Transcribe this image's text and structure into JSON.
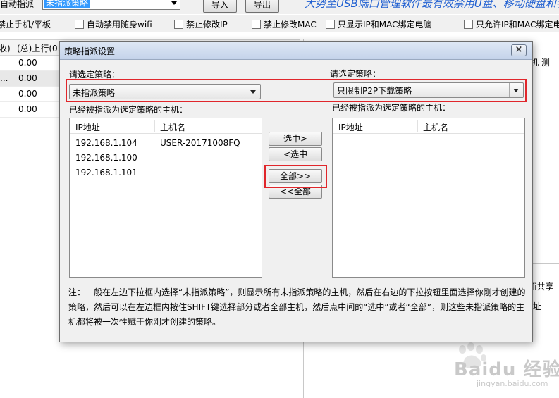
{
  "background": {
    "auto_assign_label": "自动指派",
    "policy_select_value": "未指派策略",
    "import_button": "导入",
    "export_button": "导出",
    "banner_text": "大势至USB端口管理软件最有效禁用U盘、移动硬盘和手机",
    "checkboxes": [
      "禁止手机/平板",
      "自动禁用随身wifi",
      "禁止修改IP",
      "禁止修改MAC",
      "只显示IP和MAC绑定电脑",
      "只允许IP和MAC绑定电"
    ],
    "table": {
      "col_recv": "收)",
      "col_upload": "(总)上行(0.",
      "rows": [
        {
          "left": "",
          "value": "0.00"
        },
        {
          "left": "...",
          "value": "0.00"
        },
        {
          "left": "",
          "value": "0.00"
        },
        {
          "left": "",
          "value": "0.00"
        }
      ]
    },
    "right_header": "机  测",
    "share_label": "fi共享",
    "share_sub": "址"
  },
  "dialog": {
    "title": "策略指派设置",
    "close_symbol": "×",
    "left": {
      "select_label": "请选定策略：",
      "select_value": "未指派策略",
      "assigned_label": "已经被指派为选定策略的主机：",
      "col_ip": "IP地址",
      "col_host": "主机名",
      "rows": [
        {
          "ip": "192.168.1.104",
          "host": "USER-20171008FQ"
        },
        {
          "ip": "192.168.1.100",
          "host": ""
        },
        {
          "ip": "192.168.1.101",
          "host": ""
        }
      ]
    },
    "right": {
      "select_label": "请选定策略：",
      "select_value": "只限制P2P下载策略",
      "assigned_label": "已经被指派为选定策略的主机：",
      "col_ip": "IP地址",
      "col_host": "主机名",
      "rows": []
    },
    "buttons": {
      "select_right": "选中>",
      "select_left": "<选中",
      "all_right": "全部>>",
      "all_left": "<<全部"
    },
    "note": "注：一般在左边下拉框内选择“未指派策略”，则显示所有未指派策略的主机，然后在右边的下拉按钮里面选择你刚才创建的策略，然后可以在左边框内按住SHIFT键选择部分或者全部主机，然后点中间的“选中”或者“全部”，则这些未指派策略的主机都将被一次性赋于你刚才创建的策略。"
  },
  "watermark": {
    "text": "Baidu 经验",
    "sub": "jingyan.baidu.com"
  },
  "colors": {
    "highlight_red": "#e0262b",
    "dialog_bg": "#f0f0f0",
    "selection_blue": "#3399ff",
    "banner_blue": "#1f5fd1"
  }
}
